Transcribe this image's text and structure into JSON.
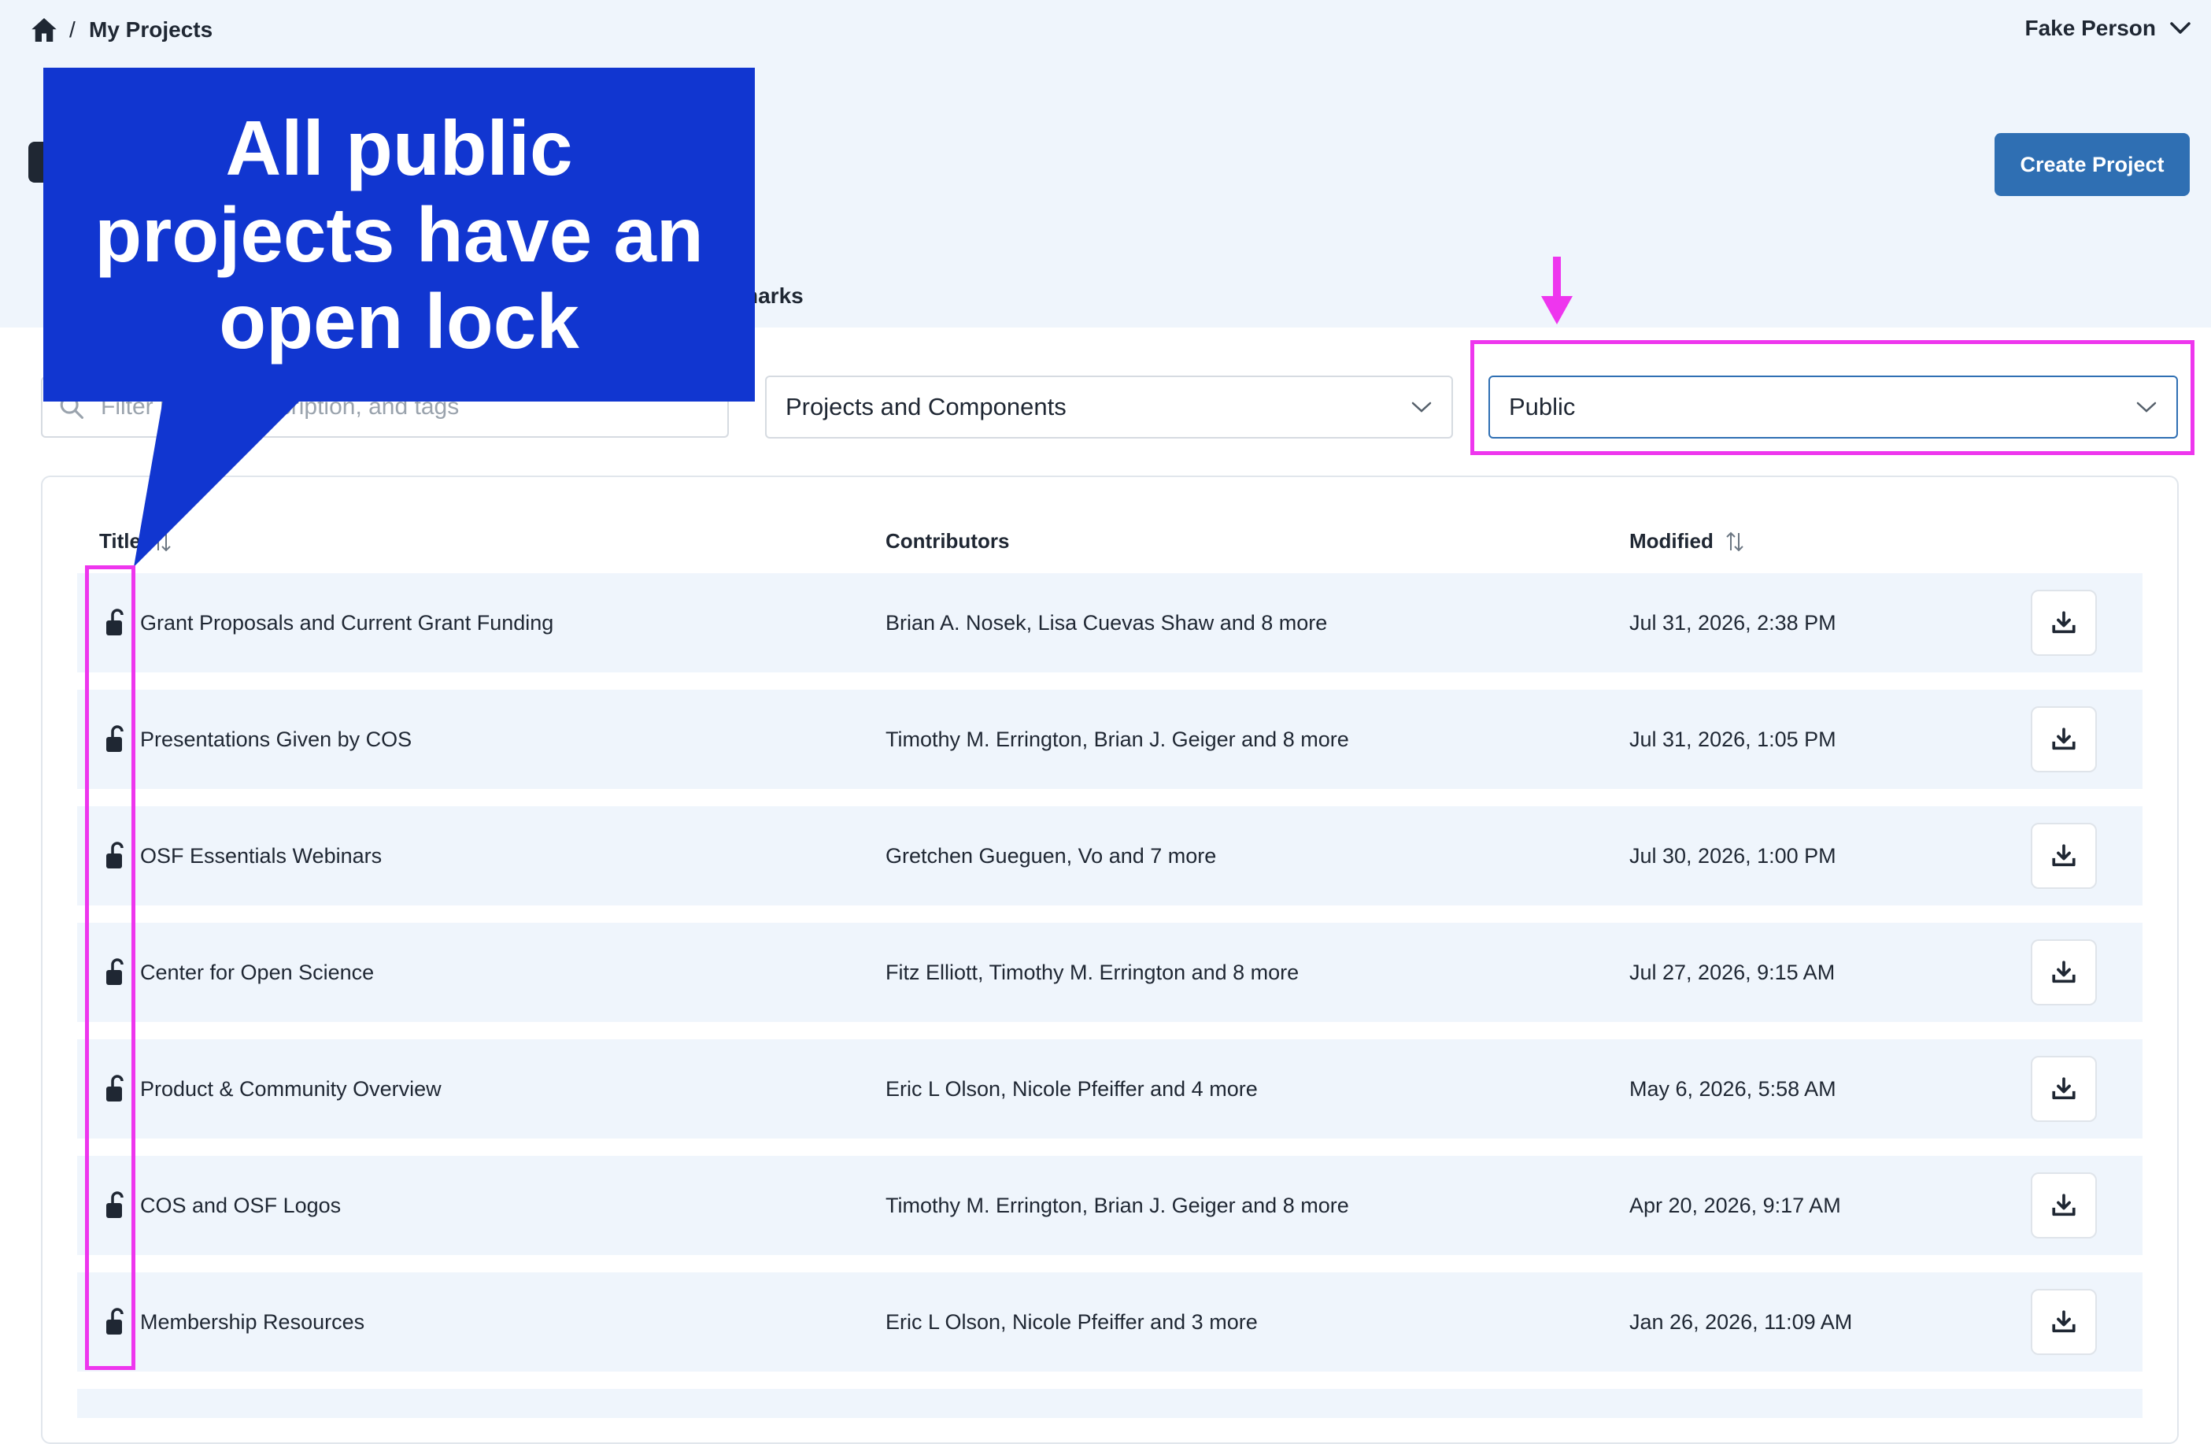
{
  "breadcrumb": {
    "separator": "/",
    "current": "My Projects"
  },
  "user_menu": {
    "name": "Fake Person"
  },
  "header": {
    "create_button": "Create Project",
    "partial_tab_text": "harks"
  },
  "filters": {
    "search_placeholder": "Filter by title, description, and tags",
    "search_visible_start": "Filter",
    "search_visible_end": "ion, and tags",
    "type_select": "Projects and Components",
    "visibility_select": "Public"
  },
  "table": {
    "columns": {
      "title": "Title",
      "contributors": "Contributors",
      "modified": "Modified"
    },
    "rows": [
      {
        "title": "Grant Proposals and Current Grant Funding",
        "contributors": "Brian A. Nosek, Lisa Cuevas Shaw and 8 more",
        "modified": "Jul 31, 2026, 2:38 PM"
      },
      {
        "title": "Presentations Given by COS",
        "contributors": "Timothy M. Errington, Brian J. Geiger and 8 more",
        "modified": "Jul 31, 2026, 1:05 PM"
      },
      {
        "title": "OSF Essentials Webinars",
        "contributors": "Gretchen Gueguen, Vo and 7 more",
        "modified": "Jul 30, 2026, 1:00 PM"
      },
      {
        "title": "Center for Open Science",
        "contributors": "Fitz Elliott, Timothy M. Errington and 8 more",
        "modified": "Jul 27, 2026, 9:15 AM"
      },
      {
        "title": "Product & Community Overview",
        "contributors": "Eric L Olson, Nicole Pfeiffer and 4 more",
        "modified": "May 6, 2026, 5:58 AM"
      },
      {
        "title": "COS and OSF Logos",
        "contributors": "Timothy M. Errington, Brian J. Geiger and 8 more",
        "modified": "Apr 20, 2026, 9:17 AM"
      },
      {
        "title": "Membership Resources",
        "contributors": "Eric L Olson, Nicole Pfeiffer and 3 more",
        "modified": "Jan 26, 2026, 11:09 AM"
      }
    ]
  },
  "annotation": {
    "callout": "All public projects have an open lock"
  },
  "icons": {
    "home": "home-icon",
    "chevron": "chevron-down-icon",
    "search": "search-icon",
    "lock": "open-lock-icon",
    "sort": "sort-icon",
    "download": "download-icon"
  },
  "colors": {
    "accent": "#2f6fb3",
    "callout": "#1136d0",
    "highlight": "#ee36ee",
    "row_bg": "#eff5fc",
    "text": "#1f2733"
  }
}
